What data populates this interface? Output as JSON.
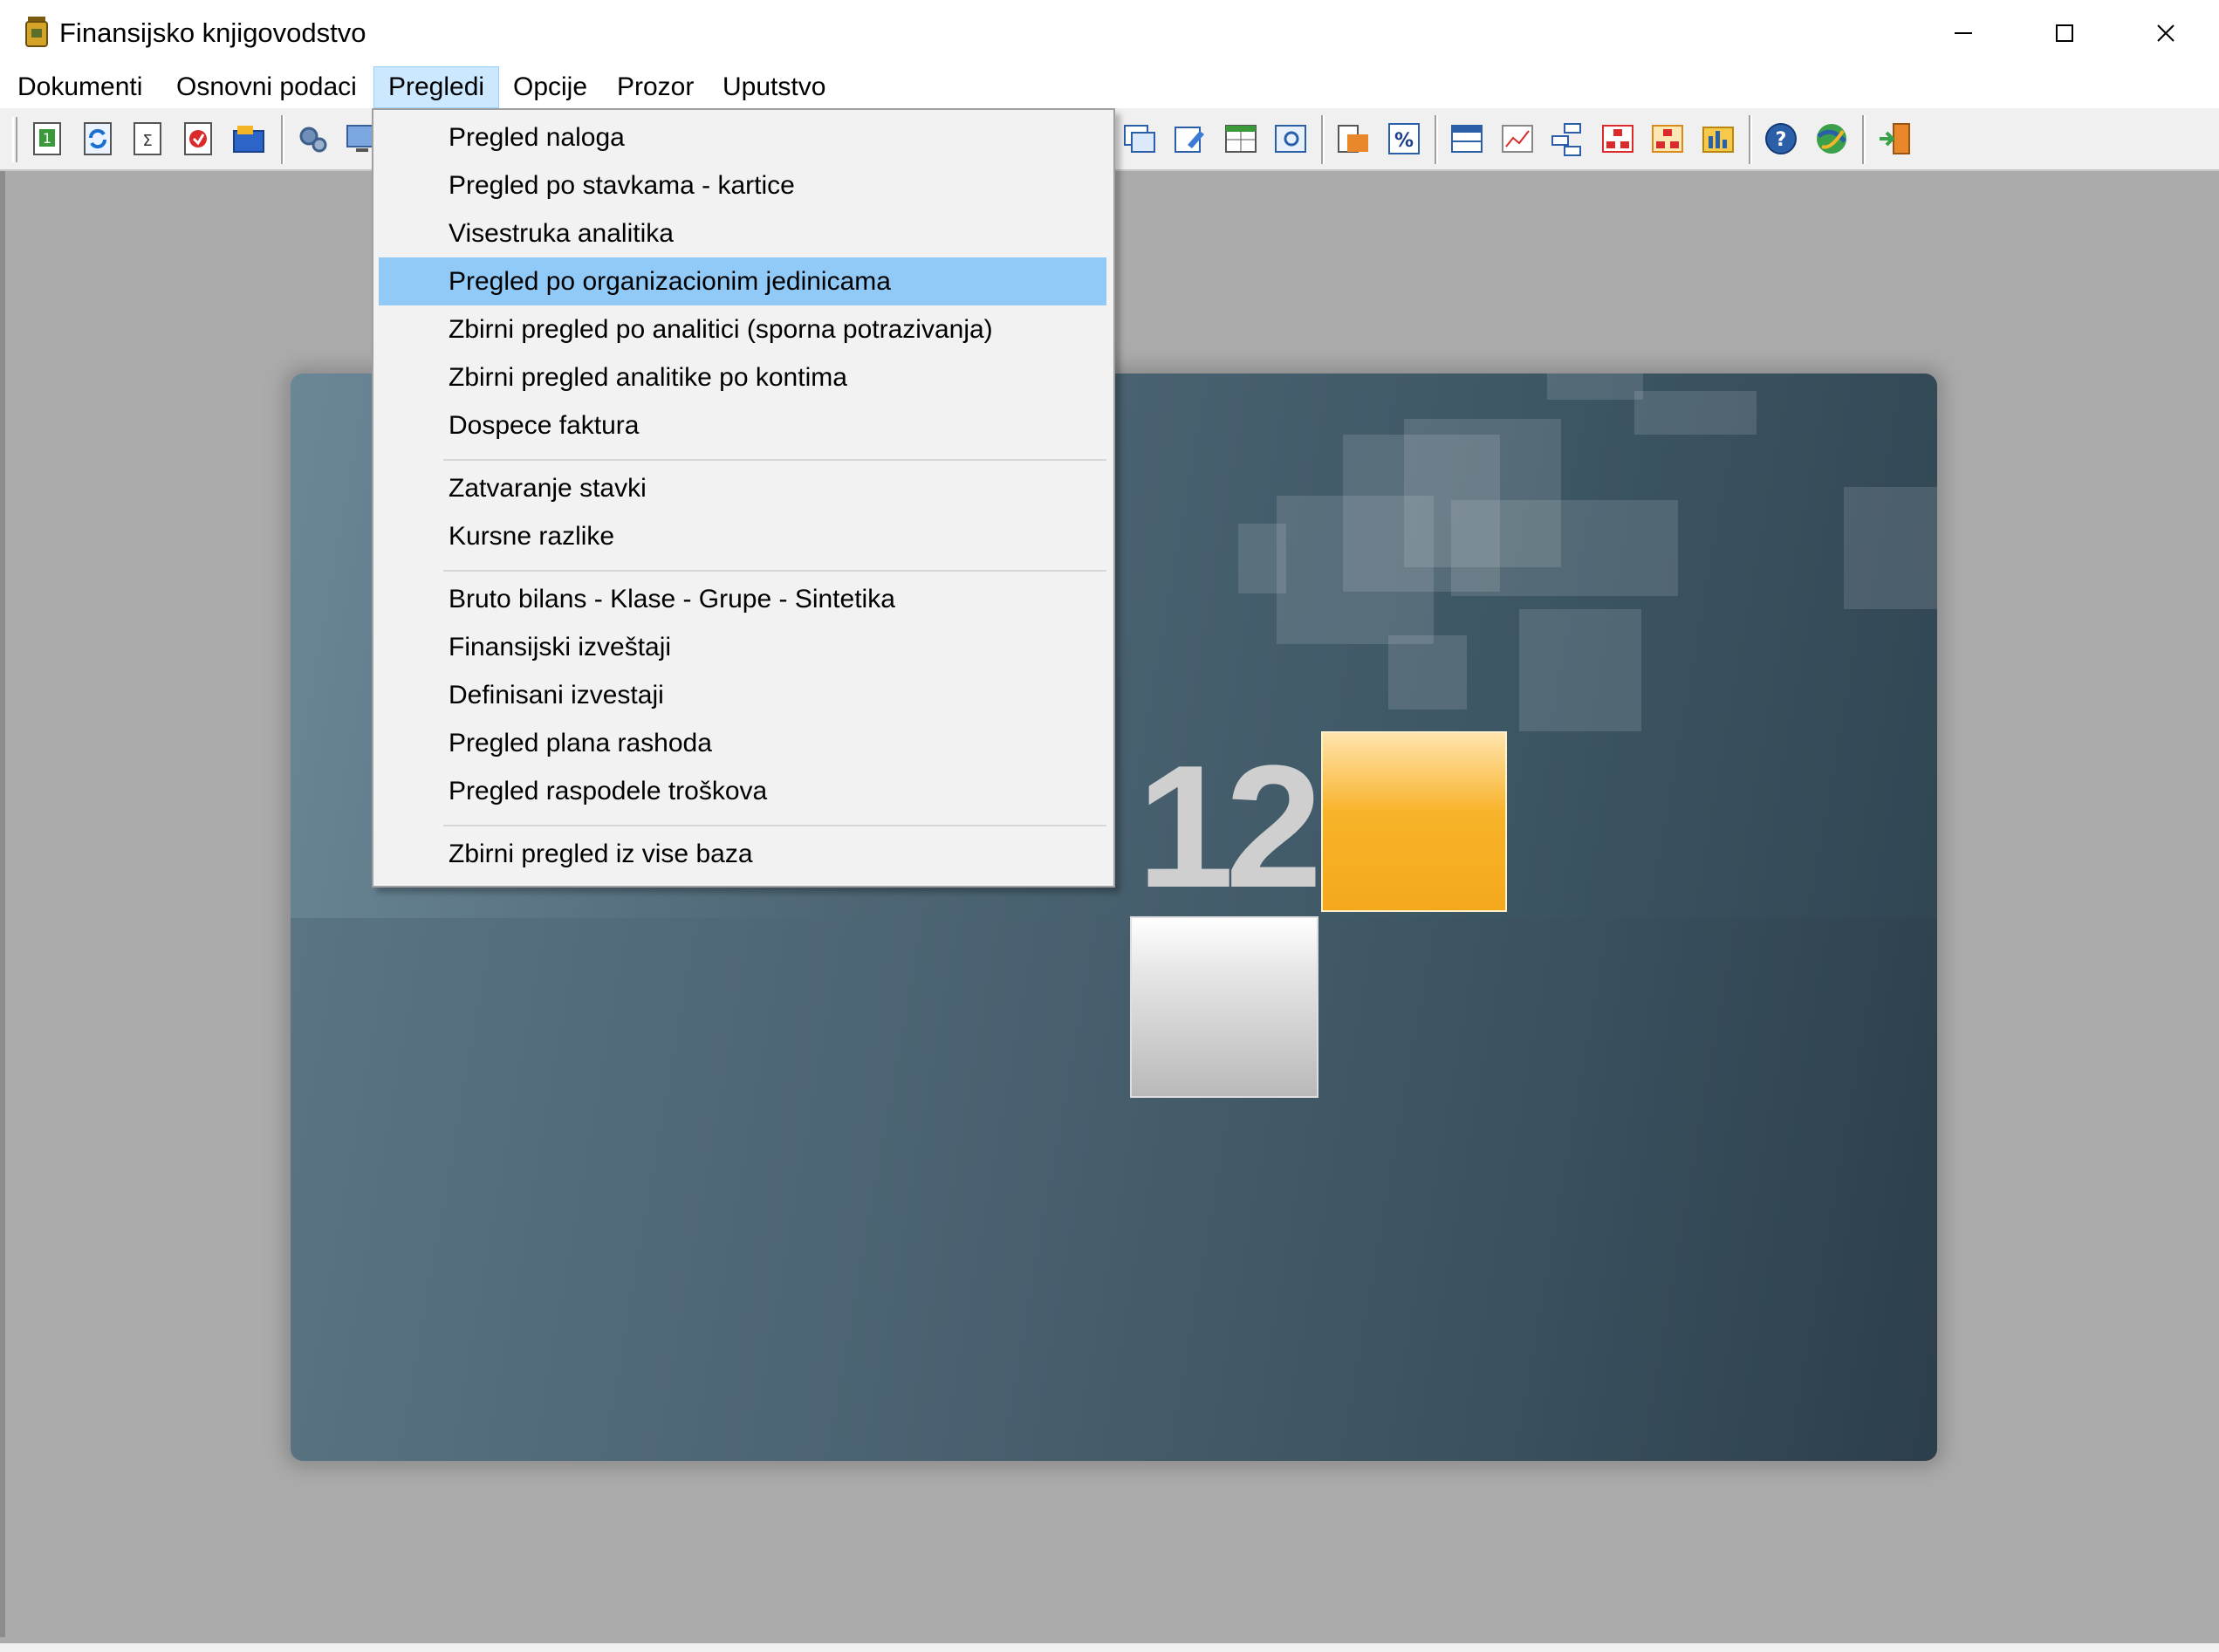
{
  "window": {
    "title": "Finansijsko knjigovodstvo",
    "controls": [
      "minimize",
      "maximize",
      "close"
    ]
  },
  "menubar": {
    "items": [
      {
        "label": "Dokumenti"
      },
      {
        "label": "Osnovni podaci"
      },
      {
        "label": "Pregledi",
        "active": true
      },
      {
        "label": "Opcije"
      },
      {
        "label": "Prozor"
      },
      {
        "label": "Uputstvo"
      }
    ]
  },
  "toolbar": {
    "icons": [
      "document-journal-icon",
      "refresh-icon",
      "calculator-icon",
      "open-folder-red-icon",
      "folder-box-icon",
      "settings-gear-icon",
      "monitor-icon",
      "window-list-icon",
      "edit-form-icon",
      "grid-table-icon",
      "table-image-icon",
      "report-folder-icon",
      "percent-icon",
      "grid-blue-icon",
      "line-chart-icon",
      "tree-diagram-icon",
      "hierarchy-red-icon",
      "hierarchy-orange-icon",
      "bar-chart-folder-icon",
      "help-icon",
      "globe-icon",
      "exit-door-icon"
    ]
  },
  "dropdown": {
    "menu": "Pregledi",
    "groups": [
      [
        "Pregled naloga",
        "Pregled po stavkama - kartice",
        "Visestruka analitika",
        "Pregled po organizacionim jedinicama",
        "Zbirni pregled po analitici (sporna potrazivanja)",
        "Zbirni pregled analitike po kontima",
        "Dospece faktura"
      ],
      [
        "Zatvaranje stavki",
        "Kursne razlike"
      ],
      [
        "Bruto bilans - Klase - Grupe - Sintetika",
        "Finansijski izveštaji",
        "Definisani izvestaji",
        "Pregled plana rashoda",
        "Pregled raspodele troškova"
      ],
      [
        "Zbirni pregled iz vise baza"
      ]
    ],
    "highlighted": "Pregled po organizacionim jedinicama"
  },
  "splash": {
    "version_number": "12",
    "colors": {
      "accent": "#f8b32a",
      "background": "#4e6675"
    }
  }
}
